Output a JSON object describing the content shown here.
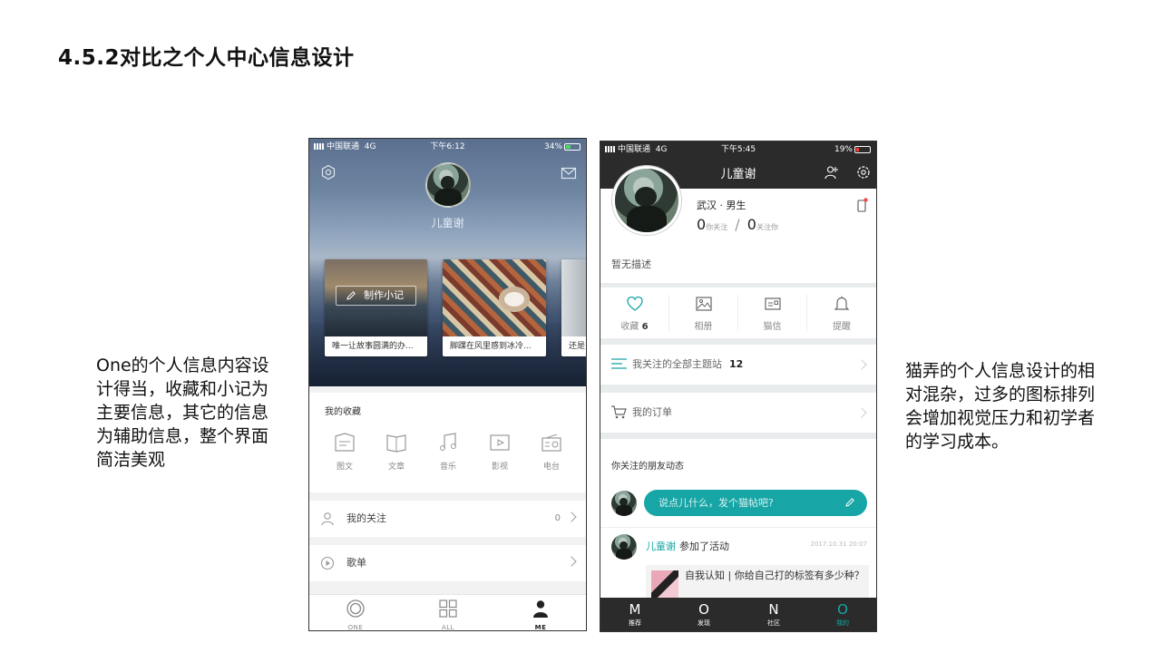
{
  "slide": {
    "title": "4.5.2对比之个人中心信息设计",
    "caption_left": "One的个人信息内容设计得当，收藏和小记为主要信息，其它的信息为辅助信息，整个界面简洁美观",
    "caption_right": "猫弄的个人信息设计的相对混杂，过多的图标排列会增加视觉压力和初学者的学习成本。"
  },
  "phone_one": {
    "status": {
      "carrier": "中国联通",
      "network": "4G",
      "time": "下午6:12",
      "battery": "34%"
    },
    "header_icons": [
      "settings-icon",
      "mail-icon"
    ],
    "username": "儿童谢",
    "make_note_label": "制作小记",
    "cards": [
      {
        "caption": "唯一让故事圆满的办..."
      },
      {
        "caption": "脚踝在风里感到冰冷..."
      },
      {
        "caption": "还是"
      }
    ],
    "favorites": {
      "title": "我的收藏",
      "items": [
        {
          "label": "图文",
          "icon": "image-text-icon"
        },
        {
          "label": "文章",
          "icon": "book-icon"
        },
        {
          "label": "音乐",
          "icon": "music-note-icon"
        },
        {
          "label": "影视",
          "icon": "video-icon"
        },
        {
          "label": "电台",
          "icon": "radio-icon"
        }
      ]
    },
    "rows": [
      {
        "label": "我的关注",
        "count": "0",
        "icon": "person-icon"
      },
      {
        "label": "歌单",
        "count": "",
        "icon": "play-circle-icon"
      }
    ],
    "tabs": [
      {
        "label": "ONE",
        "icon": "one-ring-icon",
        "active": false
      },
      {
        "label": "ALL",
        "icon": "grid-icon",
        "active": false
      },
      {
        "label": "ME",
        "icon": "person-icon",
        "active": true
      }
    ]
  },
  "phone_maonong": {
    "status": {
      "carrier": "中国联通",
      "network": "4G",
      "time": "下午5:45",
      "battery": "19%"
    },
    "nav_title": "儿童谢",
    "header_icons": [
      "add-friend-icon",
      "settings-icon"
    ],
    "profile": {
      "meta": "武汉 · 男生",
      "following_count": "0",
      "following_label": "你关注",
      "separator": "/",
      "followers_count": "0",
      "followers_label": "关注你",
      "description": "暂无描述"
    },
    "quick_items": [
      {
        "label": "收藏",
        "count": "6",
        "icon": "heart-icon"
      },
      {
        "label": "相册",
        "count": "",
        "icon": "photo-icon"
      },
      {
        "label": "猫信",
        "count": "",
        "icon": "message-card-icon"
      },
      {
        "label": "提醒",
        "count": "",
        "icon": "bell-icon"
      }
    ],
    "rows": [
      {
        "label": "我关注的全部主题站",
        "count": "12",
        "icon": "list-icon"
      },
      {
        "label": "我的订单",
        "count": "",
        "icon": "cart-icon"
      }
    ],
    "feed": {
      "title": "你关注的朋友动态",
      "input_placeholder": "说点儿什么，发个猫帖吧?",
      "item": {
        "name": "儿童谢",
        "action": "参加了活动",
        "time": "2017.10.31 20:07",
        "card_text": "自我认知 | 你给自己打的标签有多少种？"
      }
    },
    "tabs": [
      {
        "label": "推荐",
        "glyph": "M",
        "active": false
      },
      {
        "label": "发现",
        "glyph": "O",
        "active": false
      },
      {
        "label": "社区",
        "glyph": "N",
        "active": false
      },
      {
        "label": "我的",
        "glyph": "O",
        "active": true
      }
    ],
    "accent_color": "#17a5a5"
  }
}
